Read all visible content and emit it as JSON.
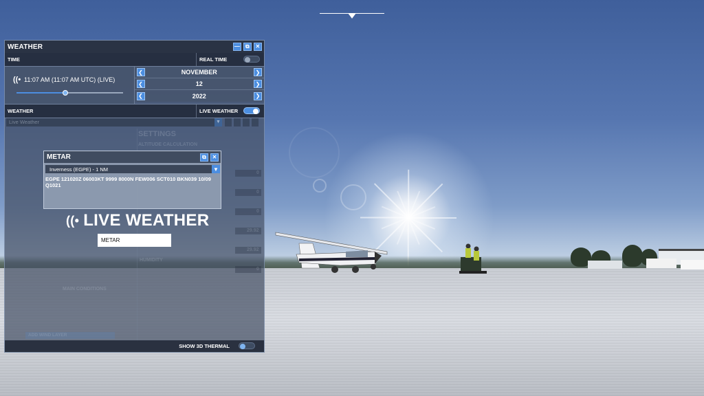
{
  "weather_panel": {
    "title": "WEATHER",
    "time_label": "TIME",
    "real_time_label": "REAL TIME",
    "time_display": "11:07 AM (11:07 AM UTC) (LIVE)",
    "time_slider_fraction": 0.46,
    "month": "NOVEMBER",
    "day": "12",
    "year": "2022",
    "weather_label": "WEATHER",
    "live_weather_label": "LIVE WEATHER",
    "live_weather_enabled": true,
    "preset_value": "Live Weather",
    "show_3d_thermal_label": "SHOW 3D THERMAL",
    "accent_color": "#4c8ee0"
  },
  "metar_window": {
    "title": "METAR",
    "station": "Inverness (EGPE) - 1 NM",
    "report_line1": "EGPE 121020Z 06003KT 9999 8000N FEW006 SCT010 BKN039 10/09",
    "report_line2": "Q1021"
  },
  "live_overlay": {
    "title": "LIVE WEATHER",
    "metar_button": "METAR"
  },
  "background_ghost": {
    "settings": "SETTINGS",
    "altitude_calc": "ALTITUDE CALCULATION",
    "values": [
      "0",
      "0",
      "0",
      "29.92",
      "29.92",
      "0"
    ],
    "humidity": "HUMIDITY",
    "wind_layer": "ADD WIND LAYER",
    "main_layer": "MAIN CONDITIONS"
  }
}
